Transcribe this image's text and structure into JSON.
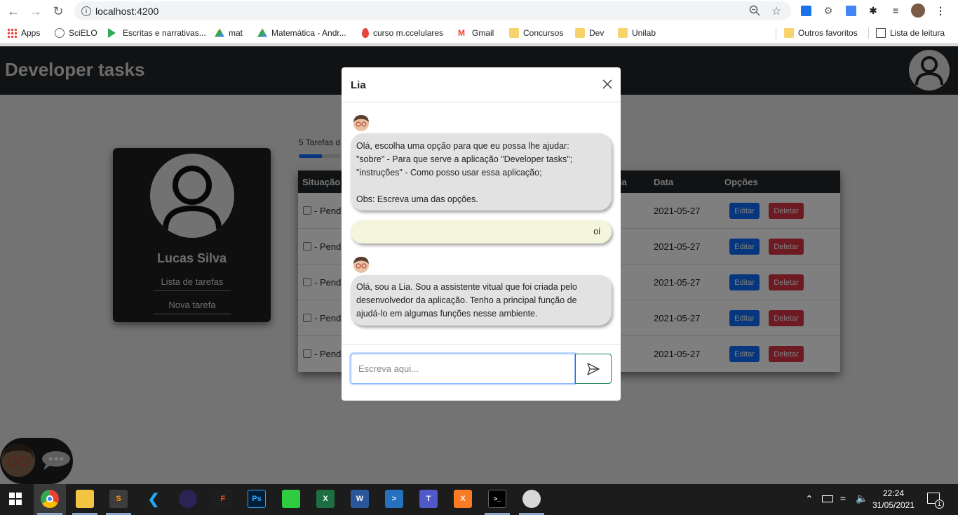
{
  "browser": {
    "url": "localhost:4200",
    "bookmarks": [
      {
        "label": "Apps"
      },
      {
        "label": "SciELO"
      },
      {
        "label": "Escritas e narrativas..."
      },
      {
        "label": "mat"
      },
      {
        "label": "Matemática - Andr..."
      },
      {
        "label": "curso m.ccelulares"
      },
      {
        "label": "Gmail"
      },
      {
        "label": "Concursos"
      },
      {
        "label": "Dev"
      },
      {
        "label": "Unilab"
      }
    ],
    "other_favorites": "Outros favoritos",
    "reading_list": "Lista de leitura"
  },
  "app": {
    "title": "Developer tasks",
    "profile": {
      "name": "Lucas Silva",
      "links": [
        "Lista de tarefas",
        "Nova tarefa"
      ]
    },
    "tasks_info": "5 Tarefas d",
    "progress_fraction": 0.55,
    "table": {
      "headers": {
        "situacao": "Situação",
        "data_partial": "ia",
        "data": "Data",
        "opcoes": "Opções"
      },
      "rows": [
        {
          "status": "- Pend",
          "date": "2021-05-27"
        },
        {
          "status": "- Pend",
          "date": "2021-05-27"
        },
        {
          "status": "- Pend",
          "date": "2021-05-27"
        },
        {
          "status": "- Pend",
          "date": "2021-05-27"
        },
        {
          "status": "- Pend",
          "date": "2021-05-27"
        }
      ],
      "edit_label": "Editar",
      "delete_label": "Deletar"
    }
  },
  "chat": {
    "title": "Lia",
    "messages": [
      {
        "from": "bot",
        "lines": [
          "Olá, escolha uma opção para que eu possa lhe ajudar:",
          "\"sobre\" - Para que serve a aplicação \"Developer tasks\";",
          "\"instruções\" - Como posso usar essa aplicação;",
          "",
          "Obs: Escreva uma das opções."
        ]
      },
      {
        "from": "user",
        "lines": [
          "oi"
        ]
      },
      {
        "from": "bot",
        "lines": [
          "Olá, sou a Lia. Sou a assistente vitual que foi criada pelo",
          "desenvolvedor da aplicação. Tenho a principal função de",
          "ajudá-lo em algumas funções nesse ambiente."
        ]
      }
    ],
    "input_placeholder": "Escreva aqui..."
  },
  "taskbar": {
    "time": "22:24",
    "date": "31/05/2021",
    "notification_count": "1"
  },
  "colors": {
    "primary": "#0d6efd",
    "danger": "#dc3545",
    "dark": "#212529",
    "send_border": "#198754"
  }
}
